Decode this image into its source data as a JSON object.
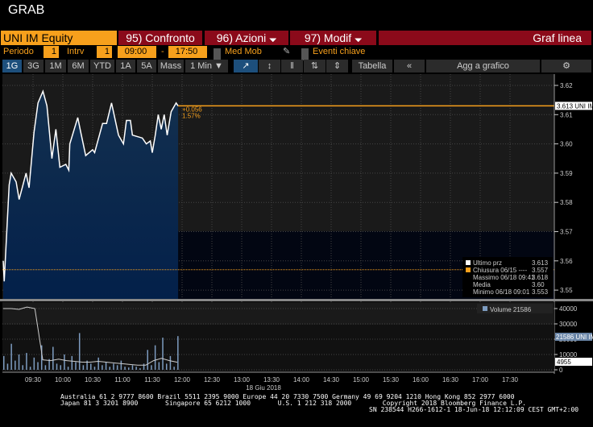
{
  "title": "GRAB",
  "toolbar": {
    "ticker": "UNI IM Equity",
    "compare": "95) Confronto",
    "actions": "96) Azioni",
    "edit": "97) Modif",
    "chart_type": "Graf linea"
  },
  "settings": {
    "period_label": "Periodo",
    "period_value": "1",
    "interval_label": "Intrv",
    "interval_value": "1",
    "start_time": "09:00",
    "separator": "-",
    "end_time": "17:50",
    "moving_avg": "Med Mob",
    "key_events": "Eventi chiave"
  },
  "ranges": [
    "1G",
    "3G",
    "1M",
    "6M",
    "YTD",
    "1A",
    "5A",
    "Mass"
  ],
  "interval_select": "1 Min ▼",
  "actions": {
    "table": "Tabella",
    "collapse": "«",
    "add_to_chart": "Agg a grafico"
  },
  "colors": {
    "orange": "#f7a01c",
    "red": "#8b0a1a",
    "fill": "#0e2a4a"
  },
  "chart_data": {
    "type": "area",
    "date_label": "18 Giu 2018",
    "x_ticks": [
      "09:30",
      "10:00",
      "10:30",
      "11:00",
      "11:30",
      "12:00",
      "12:30",
      "13:00",
      "13:30",
      "14:00",
      "14:30",
      "15:00",
      "15:30",
      "16:00",
      "16:30",
      "17:00",
      "17:30"
    ],
    "y_ticks": [
      "3.62",
      "3.61",
      "3.60",
      "3.59",
      "3.58",
      "3.57",
      "3.56",
      "3.55"
    ],
    "ylim": [
      3.55,
      3.62
    ],
    "price_minutes_from_0900": [
      0,
      1,
      6,
      8,
      13,
      16,
      23,
      26,
      31,
      35,
      40,
      44,
      49,
      53,
      57,
      63,
      66,
      67,
      75,
      78,
      83,
      90,
      92,
      100,
      104,
      109,
      116,
      121,
      124,
      128,
      130,
      140,
      144,
      148,
      150,
      153,
      156,
      159,
      162,
      165,
      169,
      174,
      176
    ],
    "price": [
      3.56,
      3.553,
      3.586,
      3.59,
      3.587,
      3.581,
      3.59,
      3.585,
      3.604,
      3.614,
      3.618,
      3.613,
      3.595,
      3.605,
      3.592,
      3.593,
      3.591,
      3.6,
      3.609,
      3.604,
      3.596,
      3.598,
      3.597,
      3.607,
      3.607,
      3.614,
      3.603,
      3.6,
      3.608,
      3.608,
      3.603,
      3.602,
      3.6,
      3.601,
      3.597,
      3.603,
      3.61,
      3.605,
      3.61,
      3.603,
      3.611,
      3.614,
      3.613
    ],
    "last_label": "3.613 UNI IM",
    "change": "+0.056",
    "change_pct": "1.57%",
    "prev_close": 3.557,
    "legend": [
      {
        "label": "Ultimo prz",
        "value": "3.613"
      },
      {
        "label": "Chiusura 06/15 ----",
        "value": "3.557"
      },
      {
        "label": "Massimo 06/18 09:41",
        "value": "3.618"
      },
      {
        "label": "Media",
        "value": "3.60"
      },
      {
        "label": "Minimo 06/18 09:01",
        "value": "3.553"
      }
    ],
    "volume_legend": "Volume 21586",
    "volume_last_label": "21586 UNI IM",
    "volume_ma_label": "4955",
    "volume_ticks": [
      "40000",
      "30000",
      "20000",
      "10000",
      "0"
    ],
    "volume_ylim": [
      0,
      45000
    ],
    "volume": [
      9000,
      4000,
      17000,
      6000,
      10000,
      3000,
      11000,
      2000,
      8000,
      5000,
      16000,
      3000,
      7000,
      15000,
      4000,
      3000,
      10000,
      2000,
      9000,
      5000,
      24000,
      3000,
      6000,
      4000,
      2000,
      8000,
      3000,
      5000,
      2000,
      4000,
      3000,
      6000,
      2000,
      1500,
      3000,
      2000,
      1000,
      4000,
      13000,
      3000,
      16000,
      5000,
      21000,
      4000,
      9000,
      2000,
      22000
    ],
    "volume_ma": [
      40000,
      40000,
      39500,
      41000,
      40000,
      6500,
      6000,
      7000,
      6000,
      5500,
      5000,
      5000,
      5500,
      5000,
      4500,
      4000,
      3500,
      3000,
      3000,
      6000,
      7500,
      6000,
      4955
    ]
  },
  "footer": {
    "line1": "Australia 61 2 9777 8600 Brazil 5511 2395 9000 Europe 44 20 7330 7500 Germany 49 69 9204 1210 Hong Kong 852 2977 6000",
    "line2": "Japan 81 3 3201 8900       Singapore 65 6212 1000       U.S. 1 212 318 2000        Copyright 2018 Bloomberg Finance L.P.",
    "line3": "SN 238544 H266-1612-1 18-Jun-18 12:12:09 CEST GMT+2:00"
  }
}
